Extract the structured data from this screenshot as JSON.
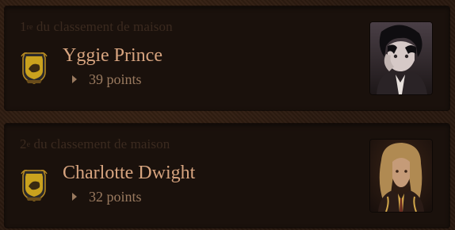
{
  "rankings": [
    {
      "rank_number": "1",
      "rank_suffix": "re",
      "rank_text": " du classement de maison",
      "name": "Yggie Prince",
      "points": "39 points",
      "crest_icon": "house-crest-icon",
      "avatar_icon": "character-portrait-icon"
    },
    {
      "rank_number": "2",
      "rank_suffix": "e",
      "rank_text": " du classement de maison",
      "name": "Charlotte Dwight",
      "points": "32 points",
      "crest_icon": "house-crest-icon",
      "avatar_icon": "character-portrait-icon"
    }
  ],
  "colors": {
    "background": "#2a1a10",
    "card": "#1a110c",
    "name": "#d7a47f",
    "points": "#9a7a5f",
    "rank_label": "#3b2a1f"
  }
}
